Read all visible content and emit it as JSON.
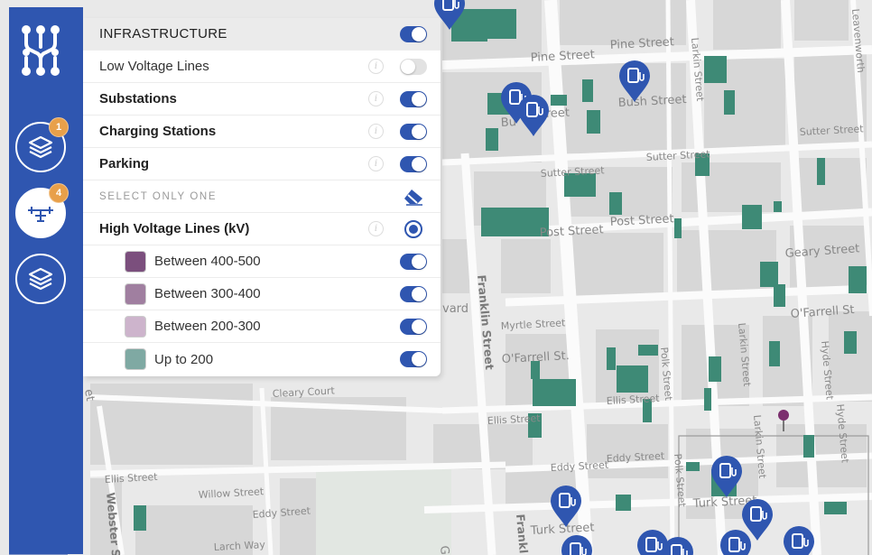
{
  "sidebar": {
    "layers_badge": "1",
    "power_badge": "4"
  },
  "panel": {
    "header": "INFRASTRUCTURE",
    "layers": [
      {
        "label": "Low Voltage Lines",
        "enabled": false
      },
      {
        "label": "Substations",
        "enabled": true
      },
      {
        "label": "Charging Stations",
        "enabled": true
      },
      {
        "label": "Parking",
        "enabled": true
      }
    ],
    "select_hint": "SELECT ONLY ONE",
    "high_voltage": {
      "label": "High Voltage Lines (kV)",
      "ranges": [
        {
          "label": "Between 400-500",
          "color": "#7b4f7d",
          "enabled": true
        },
        {
          "label": "Between 300-400",
          "color": "#a07fa0",
          "enabled": true
        },
        {
          "label": "Between 200-300",
          "color": "#cdb4cc",
          "enabled": true
        },
        {
          "label": "Up to 200",
          "color": "#7fa9a3",
          "enabled": true
        }
      ]
    }
  },
  "map": {
    "streets": {
      "pine": "Pine Street",
      "pine2": "Pine Street",
      "bush": "Bush Street",
      "bush_partial": "reet",
      "bush_partial2": "Bu",
      "sutter": "Sutter Street",
      "sutter2": "Sutter Street",
      "sutter3": "Sutter Street",
      "post": "Post Street",
      "post2": "Post Street",
      "geary": "Geary Street",
      "ofarrell": "O'Farrell St",
      "ofarrell2": "O'Farrell St.",
      "myrtle": "Myrtle Street",
      "ellis": "Ellis Street",
      "ellis2": "Ellis Street",
      "ellis3": "Ellis Street",
      "eddy": "Eddy Street",
      "eddy2": "Eddy Street",
      "eddy3": "Eddy Street",
      "turk": "Turk Street",
      "turk2": "Turk Street",
      "willow": "Willow Street",
      "larch": "Larch Way",
      "cleary": "Cleary Court",
      "franklin": "Franklin Street",
      "franklin2": "Frankl",
      "polk": "Polk Street",
      "polk2": "Polk Street",
      "larkin": "Larkin Street",
      "larkin2": "Larkin Street",
      "hyde": "Hyde Street",
      "hyde2": "Hyde Street",
      "leavenworth": "Leavenworth",
      "webster": "Webster S",
      "ward": "vard",
      "gough": "Go",
      "et": "et"
    },
    "colors": {
      "parking": "#3e8a76",
      "pin": "#2f56b0",
      "substation": "#7b2f6e"
    }
  }
}
